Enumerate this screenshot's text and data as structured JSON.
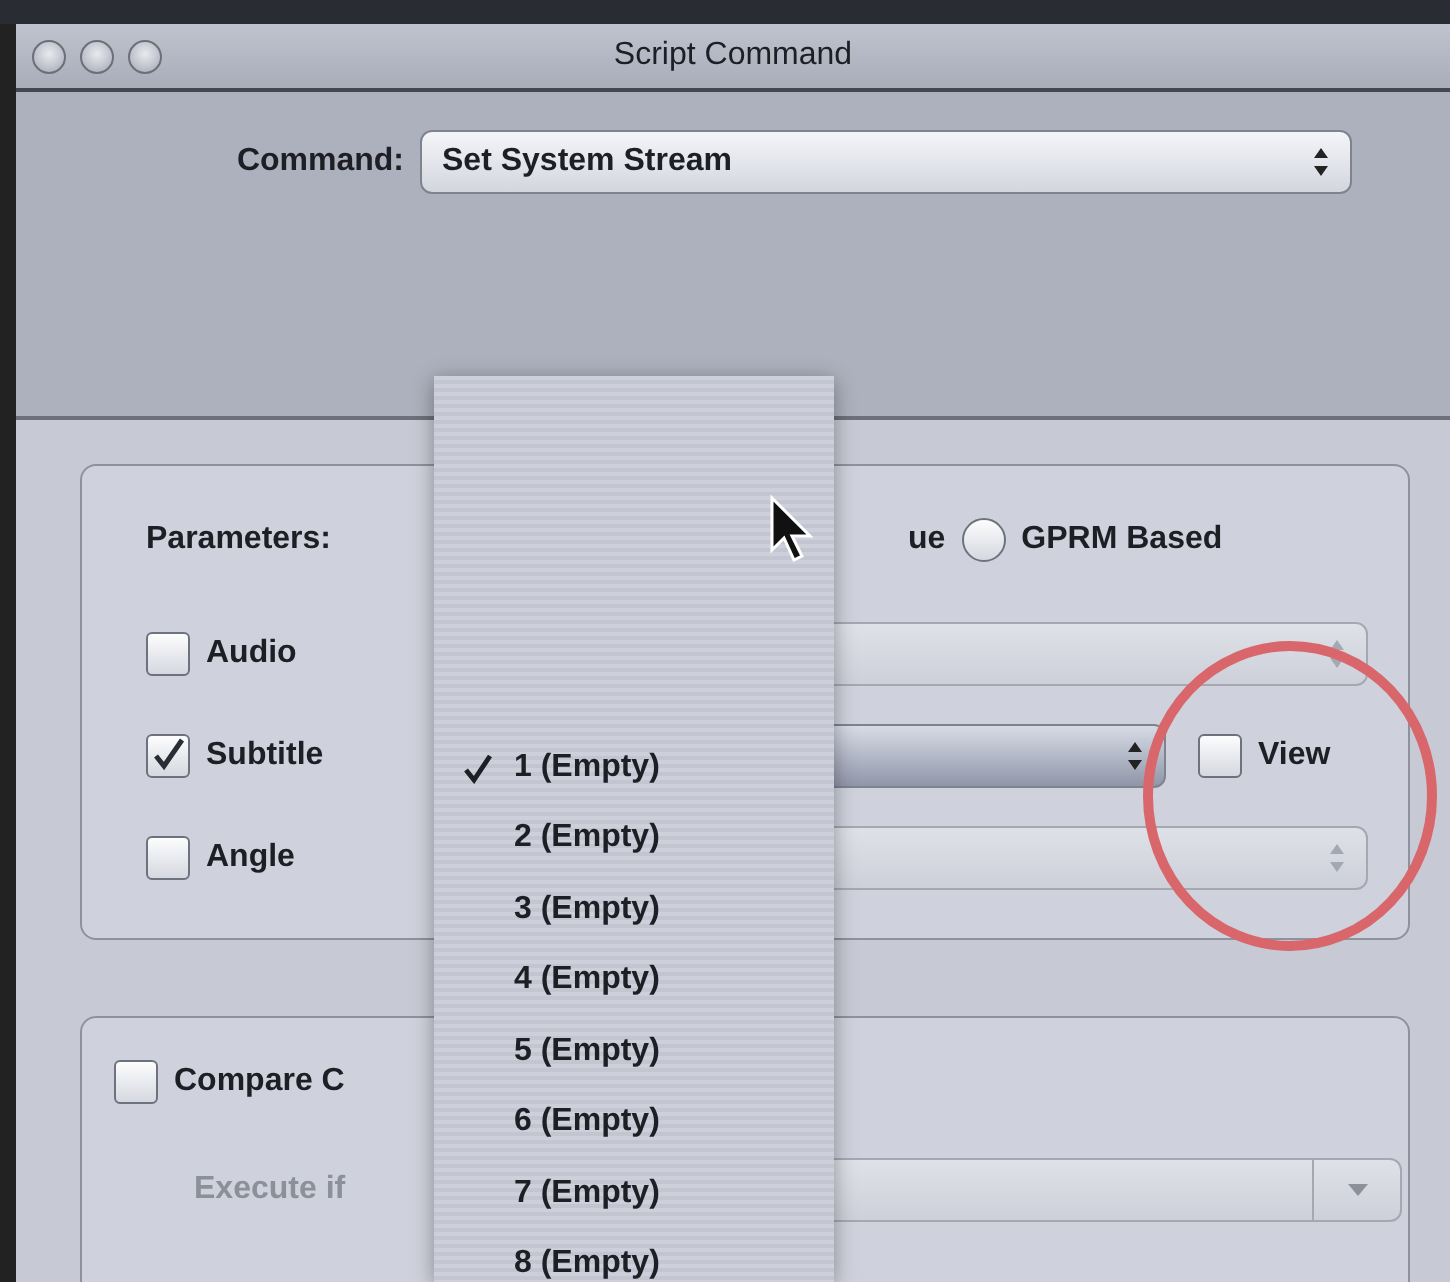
{
  "window": {
    "title": "Script Command"
  },
  "command": {
    "label": "Command:",
    "value": "Set System Stream"
  },
  "parameters": {
    "label": "Parameters:",
    "hidden_option_tail": "ue",
    "gprm": {
      "label": "GPRM Based",
      "selected": false
    }
  },
  "streams": [
    {
      "label": "Audio",
      "checked": false,
      "kind": "plain"
    },
    {
      "label": "Subtitle",
      "checked": true,
      "kind": "view",
      "view": {
        "label": "View",
        "checked": false
      }
    },
    {
      "label": "Angle",
      "checked": false,
      "kind": "plain"
    }
  ],
  "compare": {
    "label": "Compare C",
    "checked": false
  },
  "execute_if": {
    "label": "Execute if",
    "disabled": true
  },
  "menu": {
    "items": [
      {
        "label": "1 (Empty)",
        "selected": true
      },
      {
        "label": "2 (Empty)",
        "selected": false
      },
      {
        "label": "3 (Empty)",
        "selected": false
      },
      {
        "label": "4 (Empty)",
        "selected": false
      },
      {
        "label": "5 (Empty)",
        "selected": false
      },
      {
        "label": "6 (Empty)",
        "selected": false
      },
      {
        "label": "7 (Empty)",
        "selected": false
      },
      {
        "label": "8 (Empty)",
        "selected": false
      }
    ]
  }
}
